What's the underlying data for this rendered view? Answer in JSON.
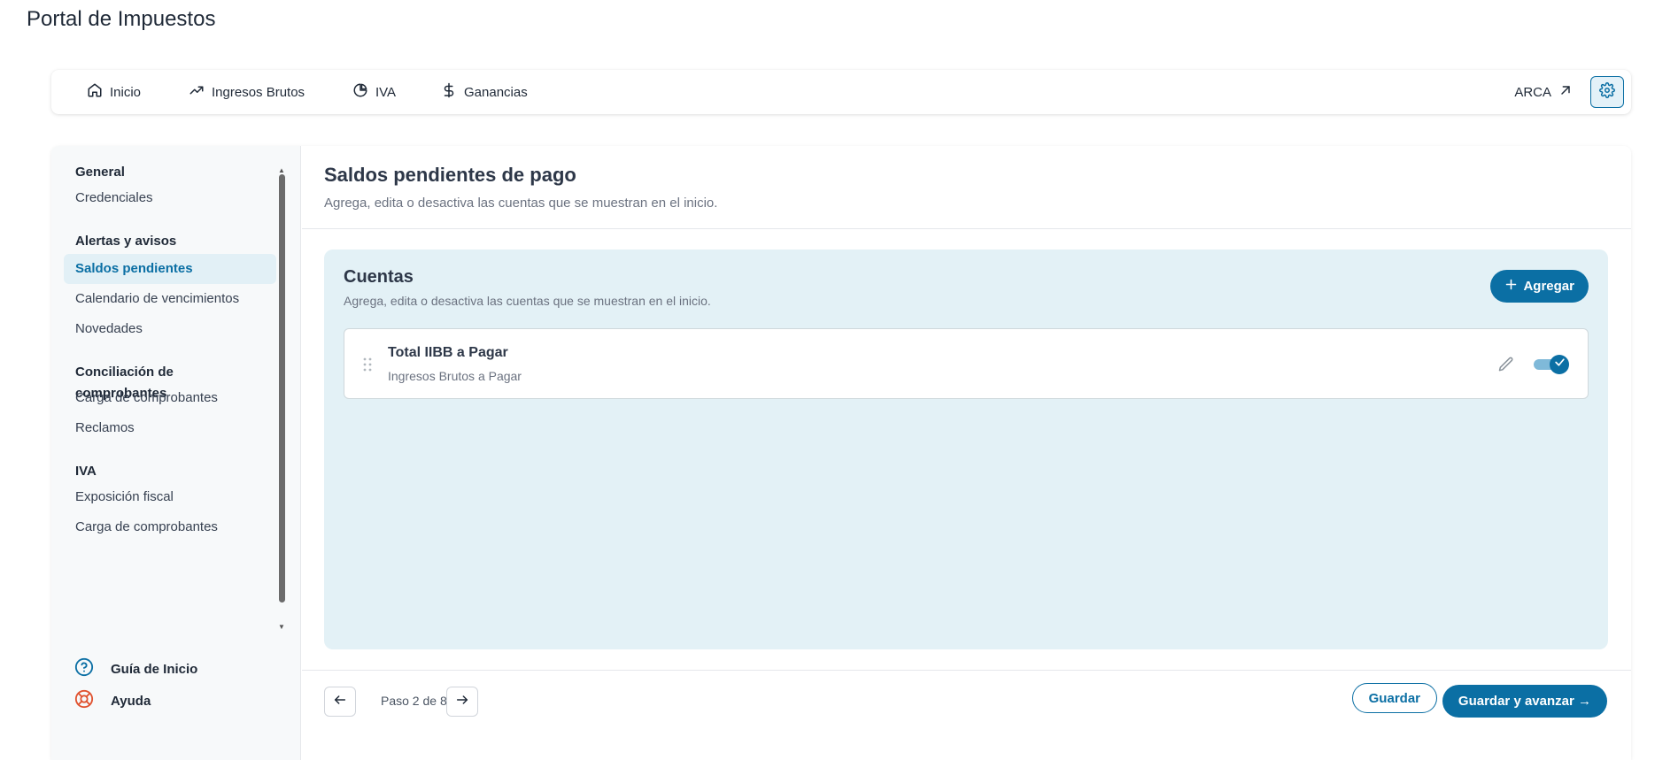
{
  "app": {
    "title": "Portal de Impuestos"
  },
  "topnav": {
    "items": [
      {
        "label": "Inicio",
        "icon": "home-icon"
      },
      {
        "label": "Ingresos Brutos",
        "icon": "trending-up-icon"
      },
      {
        "label": "IVA",
        "icon": "pie-chart-icon"
      },
      {
        "label": "Ganancias",
        "icon": "dollar-icon"
      }
    ],
    "external_link": {
      "label": "ARCA",
      "icon": "arrow-up-right-icon"
    },
    "settings_icon": "gear-icon"
  },
  "sidebar": {
    "sections": [
      {
        "title": "General",
        "items": [
          {
            "label": "Credenciales"
          }
        ]
      },
      {
        "title": "Alertas y avisos",
        "items": [
          {
            "label": "Saldos pendientes",
            "active": true
          },
          {
            "label": "Calendario de vencimientos"
          },
          {
            "label": "Novedades"
          }
        ]
      },
      {
        "title": "Conciliación de comprobantes",
        "items": [
          {
            "label": "Carga de comprobantes"
          },
          {
            "label": "Reclamos"
          }
        ]
      },
      {
        "title": "IVA",
        "items": [
          {
            "label": "Exposición fiscal"
          },
          {
            "label": "Carga de comprobantes"
          }
        ]
      }
    ],
    "bottom": [
      {
        "label": "Guía de Inicio",
        "icon": "help-circle-icon"
      },
      {
        "label": "Ayuda",
        "icon": "lifebuoy-icon"
      }
    ]
  },
  "main": {
    "title": "Saldos pendientes de pago",
    "subtitle": "Agrega, edita o desactiva las cuentas que se muestran en el inicio.",
    "accounts": {
      "title": "Cuentas",
      "subtitle": "Agrega, edita o desactiva las cuentas que se muestran en el inicio.",
      "add_label": "Agregar",
      "items": [
        {
          "name": "Total IIBB a Pagar",
          "description": "Ingresos Brutos a Pagar",
          "enabled": true
        }
      ]
    }
  },
  "footer": {
    "step_text": "Paso 2 de 8",
    "save_label": "Guardar",
    "save_next_label": "Guardar y avanzar →"
  },
  "colors": {
    "accent": "#0b6fa4",
    "accounts_bg": "#e3f1f6",
    "active_item_bg": "#e2f0f6",
    "ayuda_icon": "#e0522f"
  }
}
